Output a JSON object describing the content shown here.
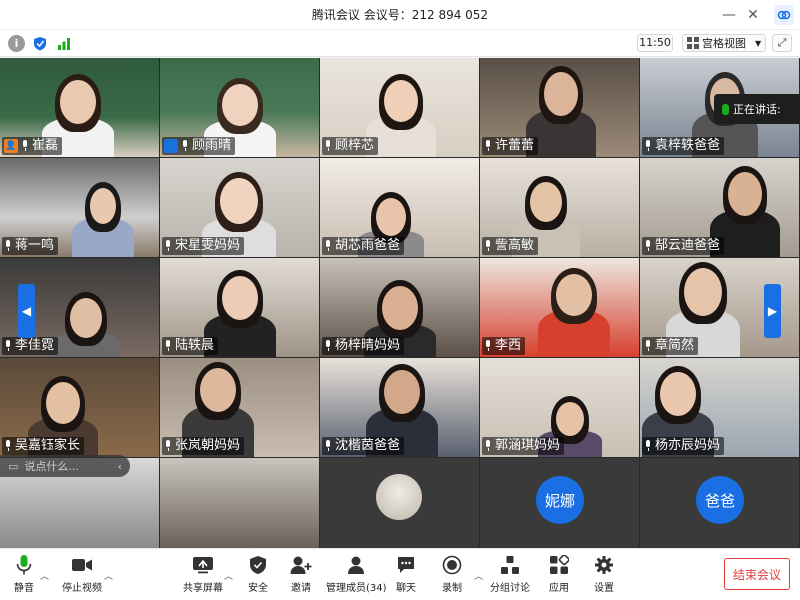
{
  "window": {
    "title": "腾讯会议 会议号：212 894 052"
  },
  "toolbar": {
    "time": "11:50",
    "view_label": "宫格视图"
  },
  "grid": {
    "speaking_label": "正在讲话: ",
    "chat_placeholder": "说点什么...",
    "tiles": [
      {
        "name": "崔磊",
        "host": true,
        "host_color": "#f07f22"
      },
      {
        "name": "顾雨晴",
        "host": true,
        "host_color": "#1b6fe4"
      },
      {
        "name": "顾梓芯"
      },
      {
        "name": "许蕾蕾"
      },
      {
        "name": "袁梓轶爸爸"
      },
      {
        "name": "蒋一鸣"
      },
      {
        "name": "宋星雯妈妈"
      },
      {
        "name": "胡芯雨爸爸"
      },
      {
        "name": "訾高敏"
      },
      {
        "name": "郜云迪爸爸"
      },
      {
        "name": "李佳霓"
      },
      {
        "name": "陆轶晨"
      },
      {
        "name": "杨梓晴妈妈"
      },
      {
        "name": "李西"
      },
      {
        "name": "章简然"
      },
      {
        "name": "吴嘉钰家长"
      },
      {
        "name": "张岚朝妈妈"
      },
      {
        "name": "沈楷茵爸爸"
      },
      {
        "name": "郭涵琪妈妈"
      },
      {
        "name": "杨亦辰妈妈"
      }
    ],
    "avatars": [
      {
        "label": "妮娜"
      },
      {
        "label": "爸爸"
      }
    ]
  },
  "bottombar": {
    "mute_label": "静音",
    "stop_video_label": "停止视频",
    "share_label": "共享屏幕",
    "security_label": "安全",
    "invite_label": "邀请",
    "members_label": "管理成员(34)",
    "chat_label": "聊天",
    "record_label": "录制",
    "breakout_label": "分组讨论",
    "apps_label": "应用",
    "settings_label": "设置",
    "end_label": "结束会议"
  },
  "colors": {
    "accent": "#1b6fe4",
    "end_red": "#e33e3e",
    "mic_green": "#1aad19"
  }
}
